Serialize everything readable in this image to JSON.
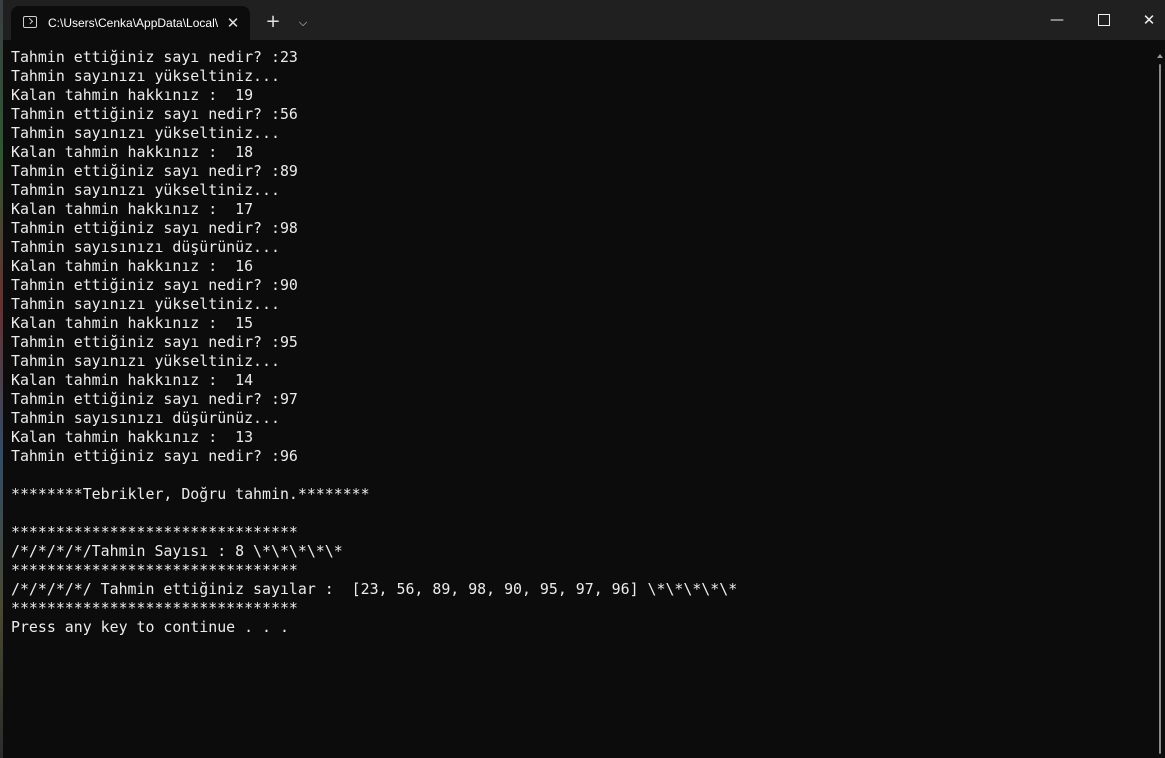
{
  "window": {
    "tab_title": "C:\\Users\\Cenka\\AppData\\Local\\",
    "tab_icon": "terminal-icon",
    "close_tab_glyph": "✕",
    "new_tab_glyph": "+",
    "dropdown_glyph": "⌵",
    "minimize_glyph": "—",
    "close_glyph": "✕"
  },
  "console": {
    "lines": [
      "Tahmin ettiğiniz sayı nedir? :23",
      "Tahmin sayınızı yükseltiniz...",
      "Kalan tahmin hakkınız :  19",
      "Tahmin ettiğiniz sayı nedir? :56",
      "Tahmin sayınızı yükseltiniz...",
      "Kalan tahmin hakkınız :  18",
      "Tahmin ettiğiniz sayı nedir? :89",
      "Tahmin sayınızı yükseltiniz...",
      "Kalan tahmin hakkınız :  17",
      "Tahmin ettiğiniz sayı nedir? :98",
      "Tahmin sayısınızı düşürünüz...",
      "Kalan tahmin hakkınız :  16",
      "Tahmin ettiğiniz sayı nedir? :90",
      "Tahmin sayınızı yükseltiniz...",
      "Kalan tahmin hakkınız :  15",
      "Tahmin ettiğiniz sayı nedir? :95",
      "Tahmin sayınızı yükseltiniz...",
      "Kalan tahmin hakkınız :  14",
      "Tahmin ettiğiniz sayı nedir? :97",
      "Tahmin sayısınızı düşürünüz...",
      "Kalan tahmin hakkınız :  13",
      "Tahmin ettiğiniz sayı nedir? :96",
      "",
      "********Tebrikler, Doğru tahmin.********",
      "",
      "********************************",
      "/*/*/*/*/Tahmin Sayısı : 8 \\*\\*\\*\\*\\*",
      "********************************",
      "/*/*/*/*/ Tahmin ettiğiniz sayılar :  [23, 56, 89, 98, 90, 95, 97, 96] \\*\\*\\*\\*\\*",
      "********************************",
      "Press any key to continue . . ."
    ]
  }
}
